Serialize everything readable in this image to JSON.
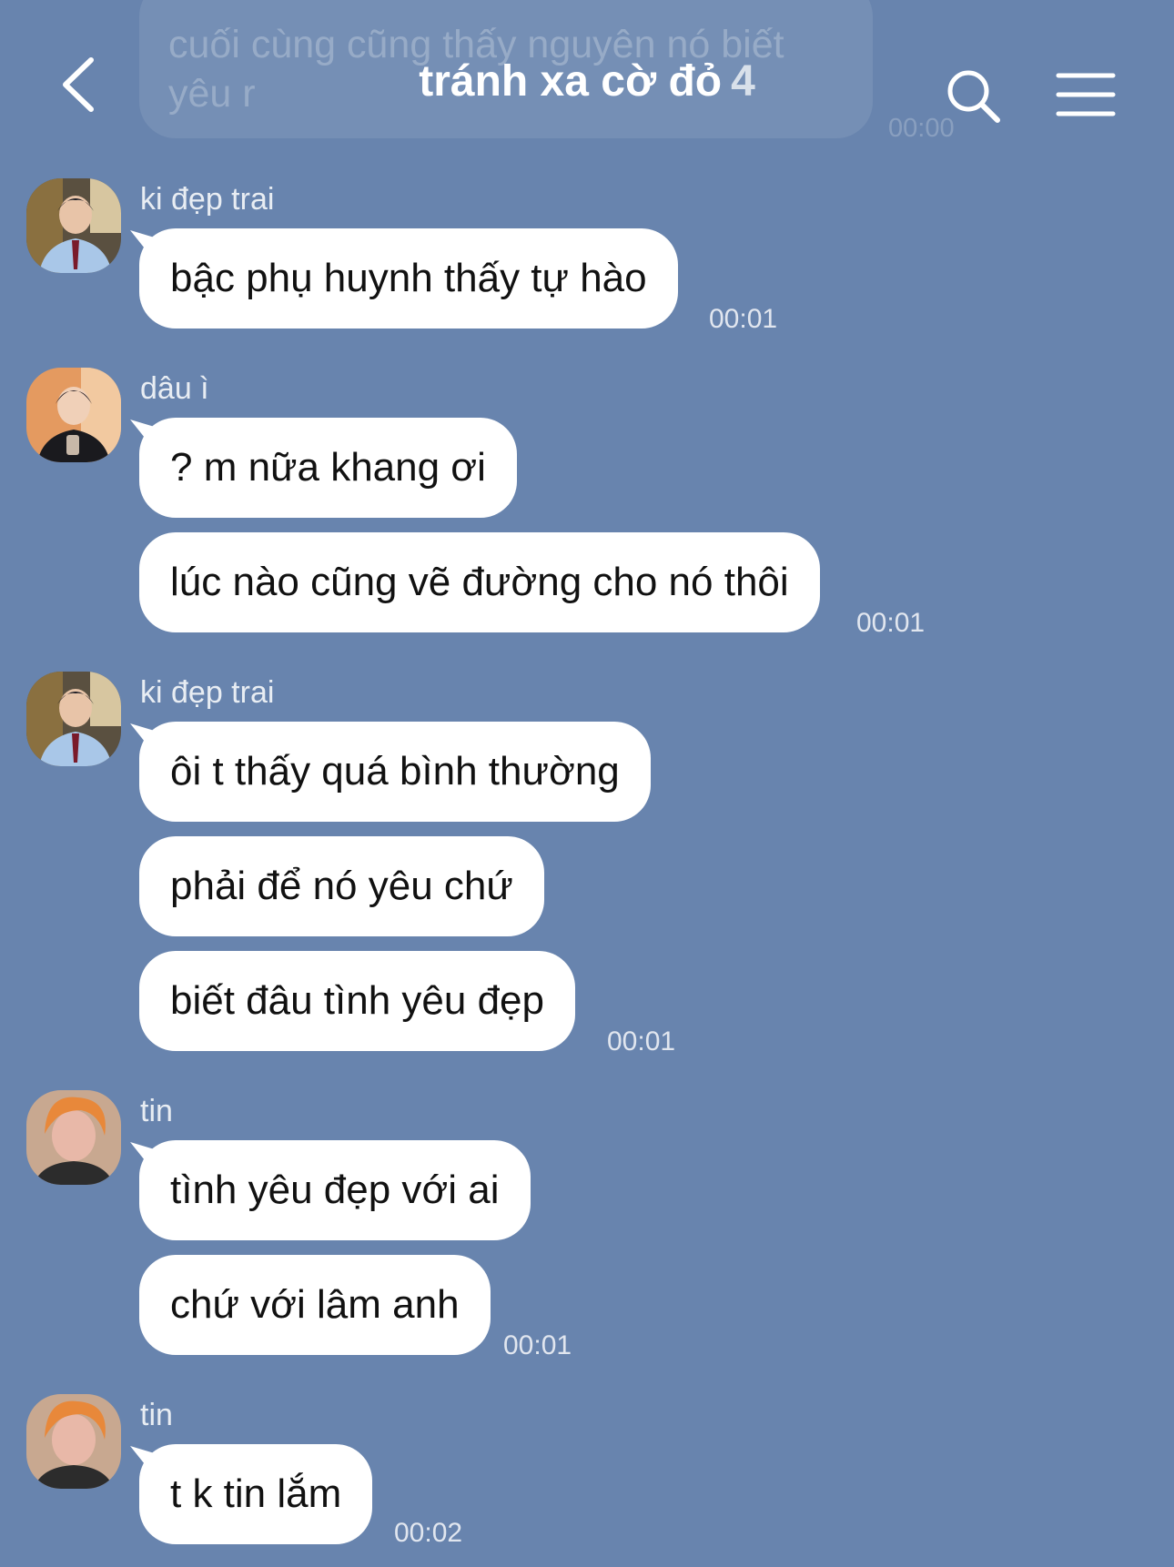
{
  "header": {
    "title": "tránh xa cờ đỏ",
    "member_count": "4",
    "ghost_message": "cuối cùng cũng thấy nguyên nó biết yêu r",
    "ghost_time": "00:00"
  },
  "icons": {
    "back": "chevron-left-icon",
    "search": "search-icon",
    "menu": "hamburger-menu-icon"
  },
  "colors": {
    "background": "#6884ae",
    "bubble": "#ffffff",
    "text": "#111111"
  },
  "messages": [
    {
      "sender": "ki đẹp trai",
      "text": "bậc phụ huynh thấy tự hào",
      "time": "00:01"
    },
    {
      "sender": "dâu ì",
      "text": "? m nữa khang ơi"
    },
    {
      "text": "lúc nào cũng vẽ đường cho nó thôi",
      "time": "00:01"
    },
    {
      "sender": "ki đẹp trai",
      "text": "ôi t thấy quá bình thường"
    },
    {
      "text": "phải để nó yêu chứ"
    },
    {
      "text": "biết đâu tình yêu đẹp",
      "time": "00:01"
    },
    {
      "sender": "tin",
      "text": "tình yêu đẹp với ai"
    },
    {
      "text": "chứ với lâm anh",
      "time": "00:01"
    },
    {
      "sender": "tin",
      "text": "t k tin lắm",
      "time": "00:02"
    }
  ]
}
